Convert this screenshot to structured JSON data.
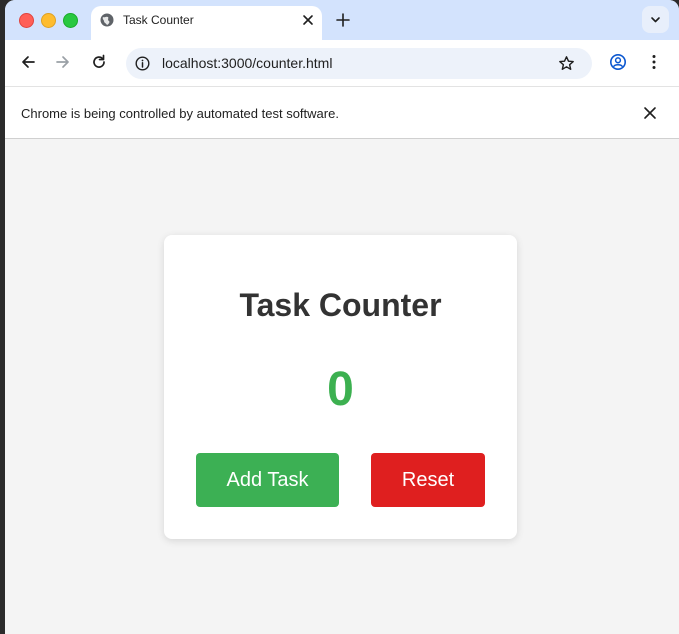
{
  "browser": {
    "tab": {
      "title": "Task Counter"
    },
    "address_bar": {
      "url": "localhost:3000/counter.html"
    },
    "infobar": {
      "message": "Chrome is being controlled by automated test software."
    }
  },
  "page": {
    "title": "Task Counter",
    "counter_value": "0",
    "buttons": {
      "add_label": "Add Task",
      "reset_label": "Reset"
    }
  },
  "colors": {
    "counter": "#3cb050",
    "add_button": "#3cb054",
    "reset_button": "#df1f1f",
    "tabstrip": "#d3e3fd"
  }
}
